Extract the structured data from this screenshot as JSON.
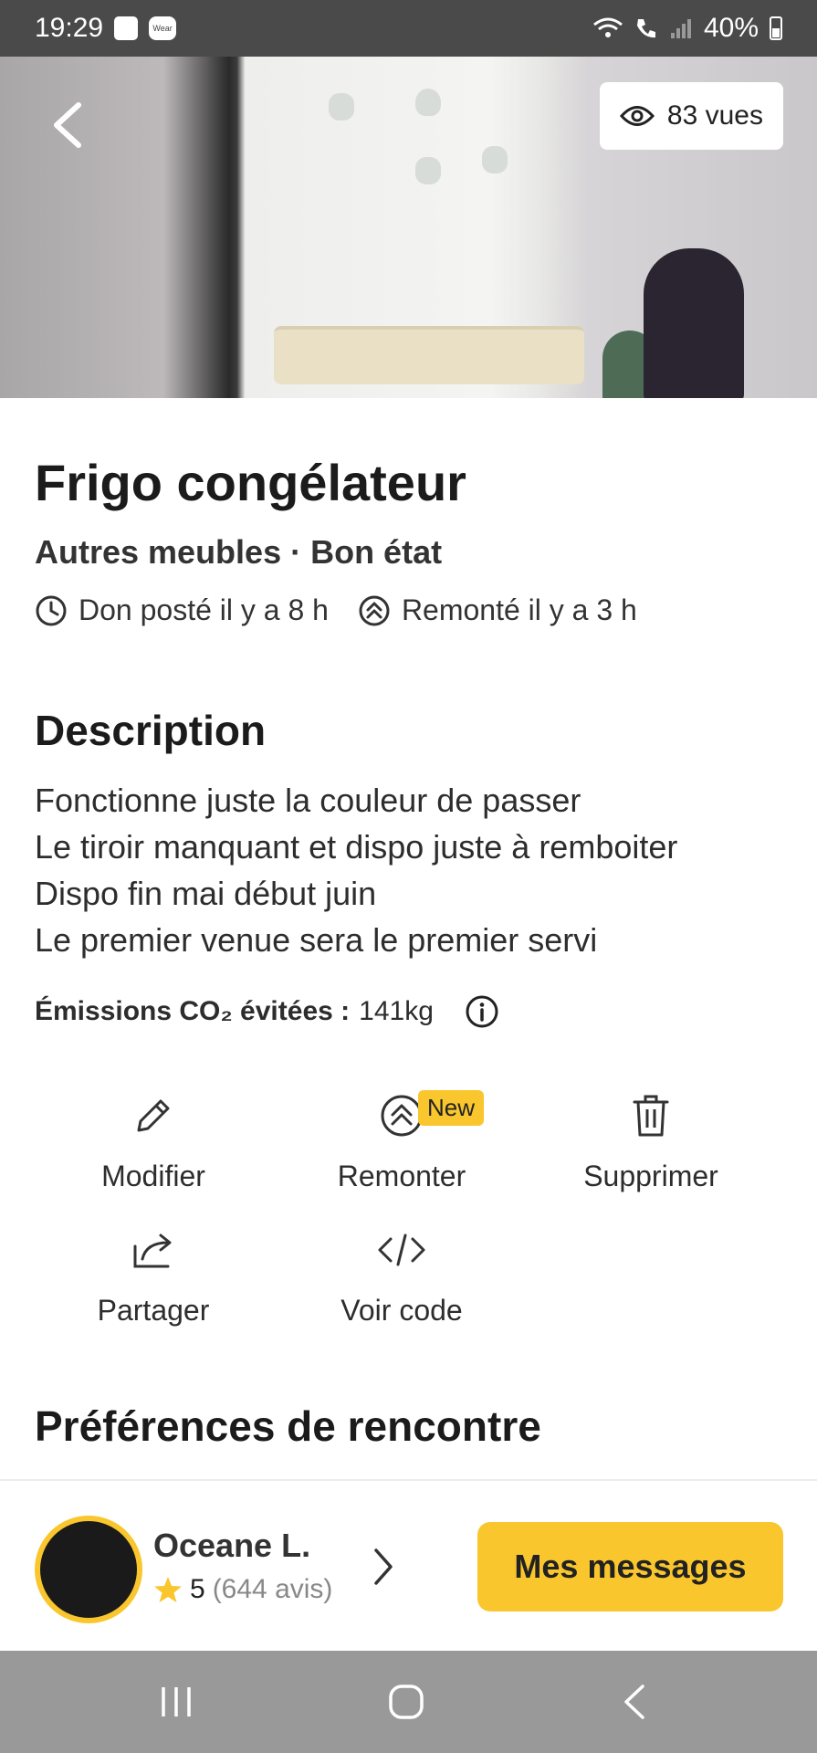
{
  "status_bar": {
    "time": "19:29",
    "wear_label": "Wear",
    "battery": "40%"
  },
  "hero": {
    "views": "83 vues"
  },
  "listing": {
    "title": "Frigo congélateur",
    "subtitle": "Autres meubles · Bon état",
    "posted": "Don posté il y a 8 h",
    "bumped": "Remonté il y a 3 h"
  },
  "description": {
    "heading": "Description",
    "lines": [
      "Fonctionne juste la couleur de passer",
      "Le tiroir manquant et dispo juste à remboiter",
      "Dispo fin mai début juin",
      "Le premier venue sera le premier servi"
    ],
    "co2_label": "Émissions CO₂ évitées :",
    "co2_value": "141kg"
  },
  "actions": {
    "edit": "Modifier",
    "bump": "Remonter",
    "bump_badge": "New",
    "delete": "Supprimer",
    "share": "Partager",
    "code": "Voir code"
  },
  "preferences": {
    "heading": "Préférences de rencontre"
  },
  "user": {
    "name": "Oceane L.",
    "rating": "5",
    "reviews": "(644 avis)"
  },
  "messages_button": "Mes messages",
  "colors": {
    "accent": "#f9c62d",
    "text": "#222222"
  },
  "icons": [
    "back-arrow-icon",
    "eye-icon",
    "clock-icon",
    "bump-icon",
    "info-icon",
    "pencil-icon",
    "trash-icon",
    "share-icon",
    "code-icon",
    "star-icon",
    "chevron-right-icon"
  ]
}
